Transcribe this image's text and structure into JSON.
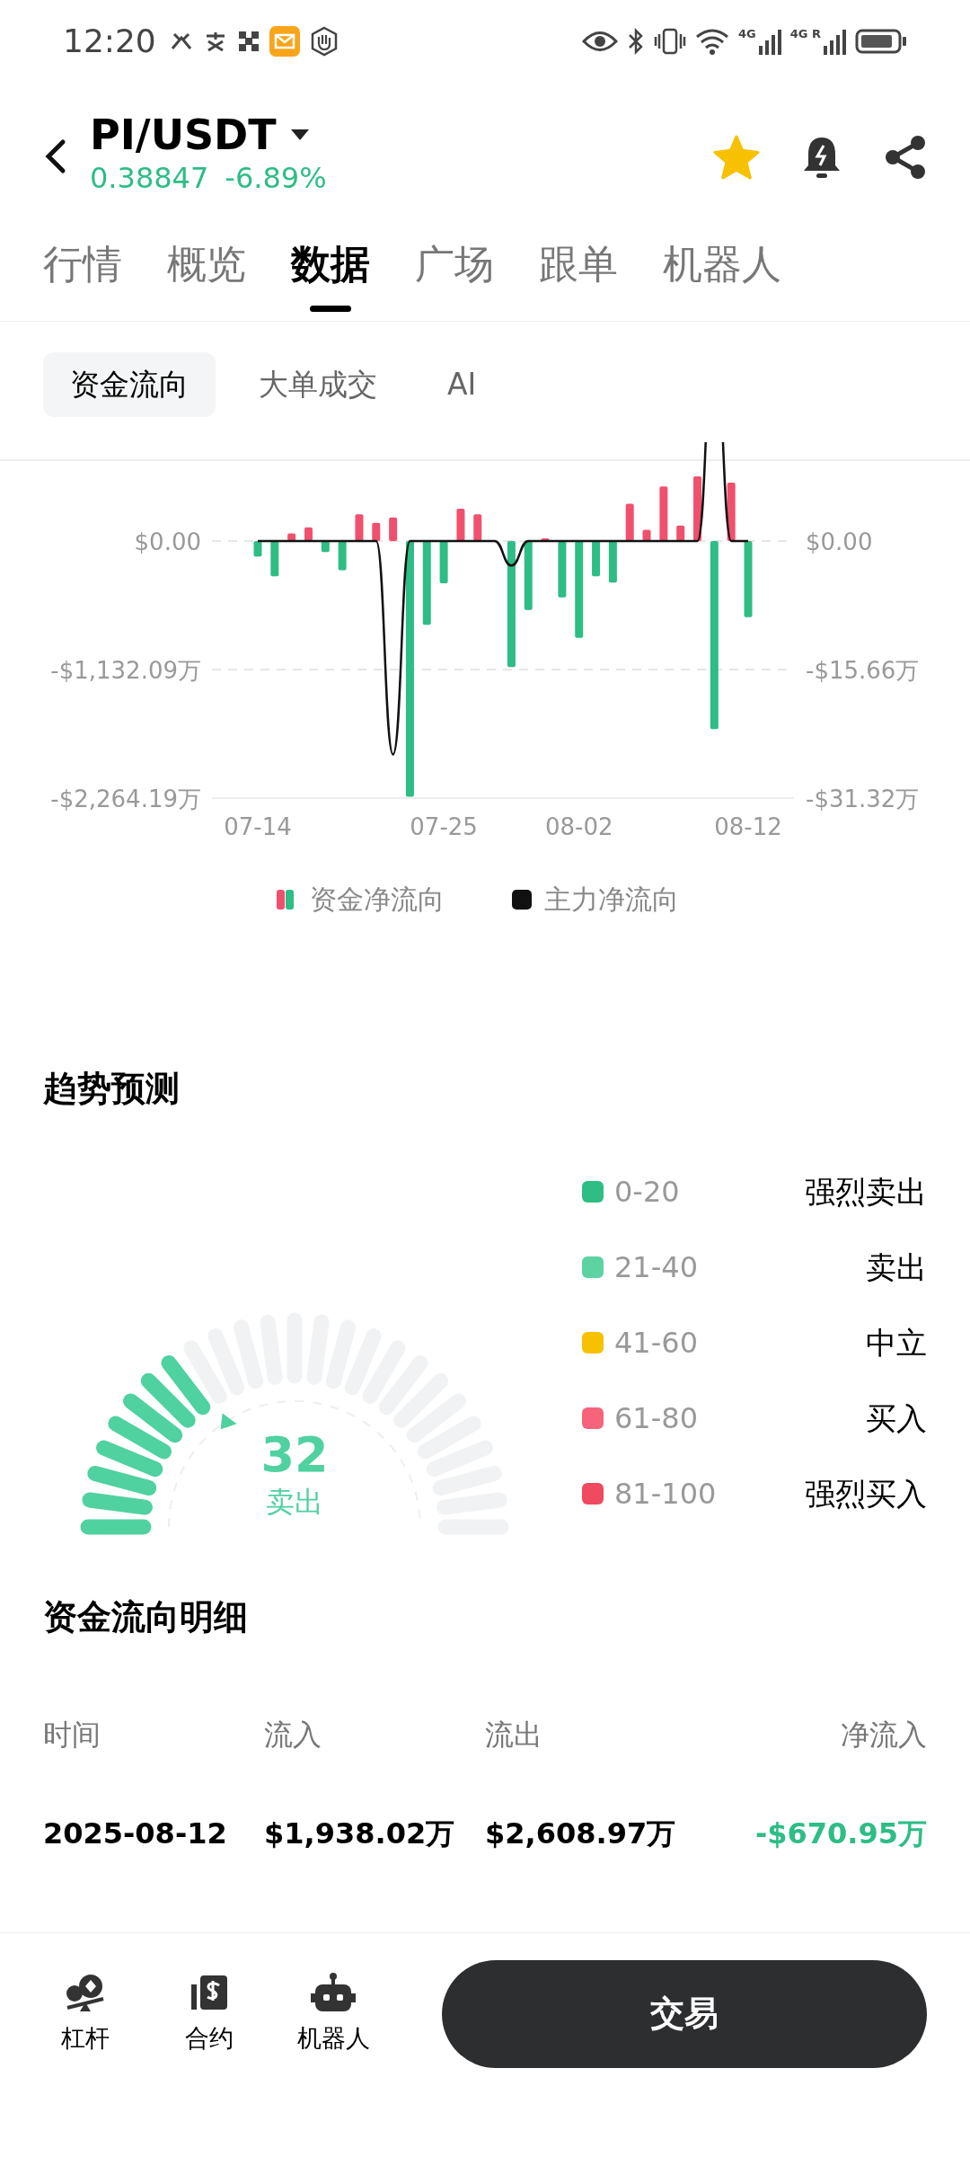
{
  "status_bar": {
    "time": "12:20",
    "signals": [
      {
        "label": "4G"
      },
      {
        "label": "4G R"
      }
    ]
  },
  "header": {
    "pair": "PI/USDT",
    "price": "0.38847",
    "change": "-6.89%",
    "falling": true,
    "favorite": true
  },
  "tabs": [
    {
      "label": "行情",
      "selected": false
    },
    {
      "label": "概览",
      "selected": false
    },
    {
      "label": "数据",
      "selected": true
    },
    {
      "label": "广场",
      "selected": false
    },
    {
      "label": "跟单",
      "selected": false
    },
    {
      "label": "机器人",
      "selected": false
    }
  ],
  "subtabs": [
    {
      "label": "资金流向",
      "selected": true
    },
    {
      "label": "大单成交",
      "selected": false
    },
    {
      "label": "AI",
      "selected": false
    }
  ],
  "flow_chart": {
    "chart_data": {
      "type": "bar",
      "categories": [
        "07-14",
        null,
        null,
        null,
        null,
        null,
        null,
        null,
        null,
        null,
        null,
        "07-25",
        null,
        null,
        null,
        null,
        null,
        null,
        null,
        "08-02",
        null,
        null,
        null,
        null,
        null,
        null,
        null,
        null,
        null,
        "08-12"
      ],
      "series": [
        {
          "name": "资金净流向",
          "type": "bar",
          "color": "#2ebd85",
          "colors": [
            "#2ebd85",
            "#2ebd85",
            "#f0506e",
            "#f0506e",
            "#2ebd85",
            "#2ebd85",
            "#f0506e",
            "#f0506e",
            "#f0506e",
            "#2ebd85",
            "#2ebd85",
            "#2ebd85",
            "#f0506e",
            "#f0506e",
            null,
            "#2ebd85",
            "#2ebd85",
            "#f0506e",
            "#2ebd85",
            "#2ebd85",
            "#2ebd85",
            "#2ebd85",
            "#f0506e",
            "#f0506e",
            "#f0506e",
            "#f0506e",
            "#f0506e",
            "#2ebd85",
            "#f0506e",
            "#2ebd85"
          ],
          "values": [
            -137,
            -312,
            66,
            120,
            -98,
            -257,
            235,
            159,
            208,
            -2253,
            -738,
            -372,
            284,
            235,
            0,
            -1110,
            -607,
            22,
            -498,
            -853,
            -312,
            -366,
            328,
            98,
            481,
            137,
            569,
            -1657,
            514,
            -671
          ]
        },
        {
          "name": "主力净流向",
          "type": "line",
          "axis": "y2",
          "color": "#111111",
          "values": [
            0,
            0,
            0,
            0,
            0,
            0,
            0,
            0,
            -26,
            0,
            0,
            0,
            0,
            0,
            0,
            -3,
            0,
            0,
            0,
            0,
            0,
            0,
            0,
            0,
            0,
            0,
            0,
            null,
            0,
            0
          ]
        }
      ],
      "legend": true,
      "ylim": [
        -2264.19,
        712
      ],
      "y2lim": [
        -31.32,
        9.85
      ],
      "yticks": [
        {
          "value": 0,
          "label": "$0.00"
        },
        {
          "value": -1132.09,
          "label": "-$1,132.09万"
        },
        {
          "value": -2264.19,
          "label": "-$2,264.19万"
        }
      ],
      "y2ticks": [
        {
          "value": 0,
          "label": "$0.00"
        },
        {
          "value": -15.66,
          "label": "-$15.66万"
        },
        {
          "value": -31.32,
          "label": "-$31.32万"
        }
      ]
    }
  },
  "trend": {
    "title": "趋势预测",
    "gauge": {
      "value": "32",
      "label": "卖出",
      "color": "#4fd1a0"
    },
    "legend": [
      {
        "range": "0-20",
        "label": "强烈卖出",
        "color": "#2ebd85"
      },
      {
        "range": "21-40",
        "label": "卖出",
        "color": "#5cd3a1"
      },
      {
        "range": "41-60",
        "label": "中立",
        "color": "#f7c100"
      },
      {
        "range": "61-80",
        "label": "买入",
        "color": "#f6647c"
      },
      {
        "range": "81-100",
        "label": "强烈买入",
        "color": "#f04a60"
      }
    ]
  },
  "details": {
    "title": "资金流向明细",
    "columns": [
      "时间",
      "流入",
      "流出",
      "净流入"
    ],
    "rows": [
      {
        "time": "2025-08-12",
        "inflow": "$1,938.02万",
        "outflow": "$2,608.97万",
        "net": "-$670.95万",
        "negative": true
      }
    ]
  },
  "bottom_bar": {
    "items": [
      {
        "kind": "leverage",
        "label": "杠杆"
      },
      {
        "kind": "contract",
        "label": "合约"
      },
      {
        "kind": "robot",
        "label": "机器人"
      }
    ],
    "trade_button": "交易"
  }
}
